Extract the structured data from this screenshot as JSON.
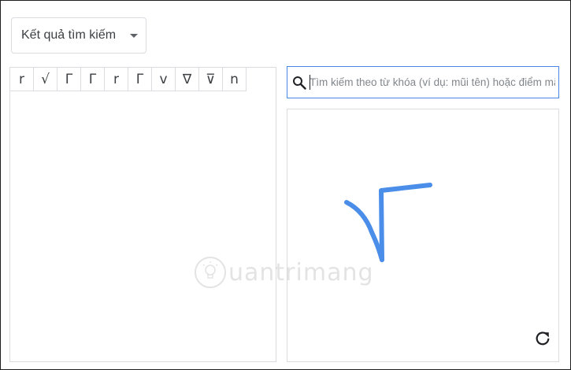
{
  "dropdown": {
    "label": "Kết quả tìm kiếm"
  },
  "results": {
    "characters": [
      "r",
      "√",
      "Γ",
      "Γ",
      "r",
      "Γ",
      "v",
      "∇",
      "⊽",
      "n"
    ]
  },
  "search": {
    "placeholder": "Tìm kiếm theo từ khóa (ví dụ: mũi tên) hoặc điểm mã",
    "value": ""
  },
  "watermark": {
    "text": "uantrimang"
  },
  "colors": {
    "accent": "#4a86e8",
    "stroke": "#4a8eea",
    "border": "#dadce0"
  },
  "icons": {
    "search": "search-icon",
    "reset": "reset-icon",
    "dropdown": "chevron-down-icon"
  }
}
